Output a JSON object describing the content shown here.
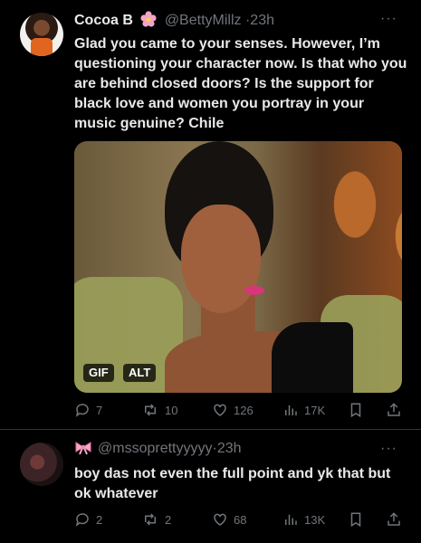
{
  "tweets": [
    {
      "name": "Cocoa B",
      "handle": "@BettyMillz",
      "time": "23h",
      "text": "Glad you came to your senses. However, I’m questioning your character now. Is that who you are behind closed doors? Is the support for black love and women you portray in your music genuine? Chile",
      "media": {
        "gif_label": "GIF",
        "alt_label": "ALT"
      },
      "stats": {
        "replies": "7",
        "retweets": "10",
        "likes": "126",
        "views": "17K"
      }
    },
    {
      "name": "",
      "handle": "@mssoprettyyyyy",
      "time": "23h",
      "text": "boy das not even the full point and yk that but ok whatever",
      "stats": {
        "replies": "2",
        "retweets": "2",
        "likes": "68",
        "views": "13K"
      }
    }
  ],
  "icons": {
    "name_badge": "flower-emoji-icon",
    "handle_badge": "ribbon-emoji-icon",
    "reply": "reply-icon",
    "retweet": "retweet-icon",
    "like": "heart-icon",
    "views": "views-icon",
    "bookmark": "bookmark-icon",
    "share": "share-icon",
    "more": "more-icon"
  },
  "colors": {
    "background": "#000000",
    "text": "#e7e9ea",
    "secondary": "#71767b",
    "divider": "#2f3336"
  }
}
